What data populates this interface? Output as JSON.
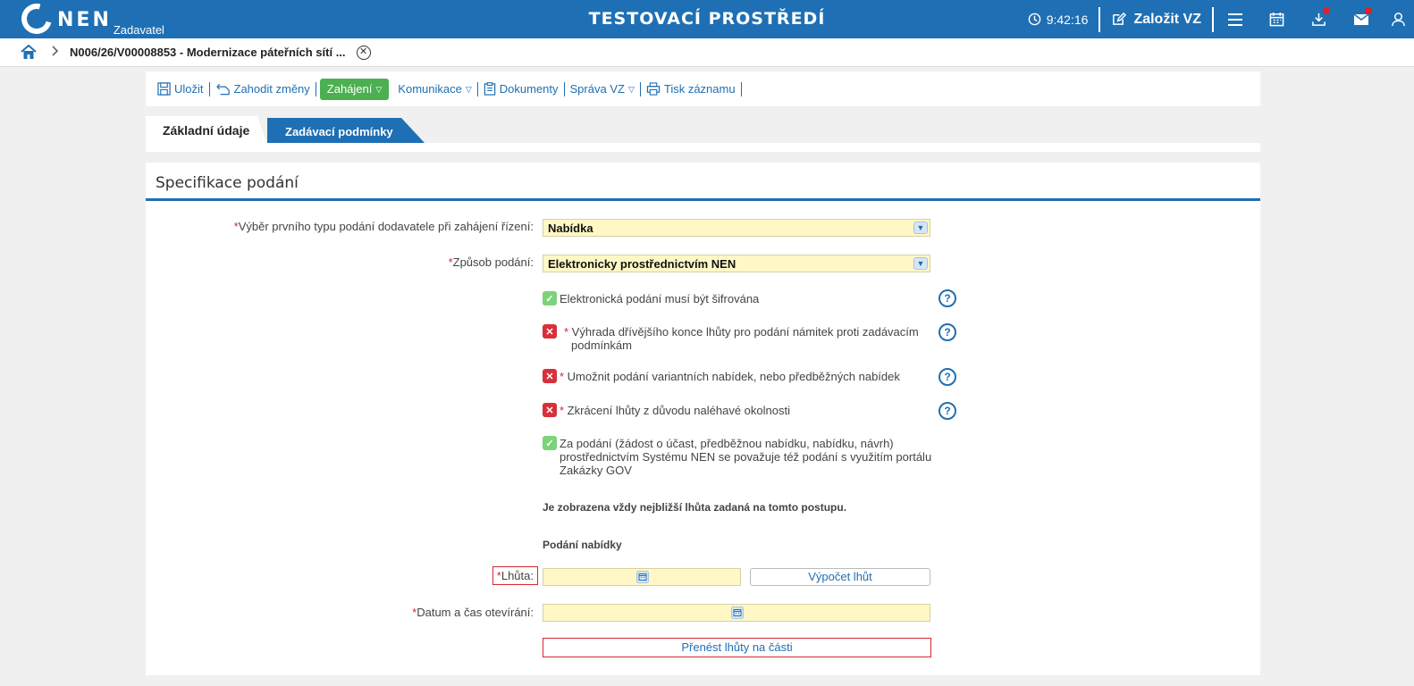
{
  "header": {
    "logo_text": "NEN",
    "logo_sub": "Zadavatel",
    "env_title": "TESTOVACÍ PROSTŘEDÍ",
    "clock": "9:42:16",
    "new_button": "Založit VZ"
  },
  "breadcrumb": {
    "title": "N006/26/V00008853 - Modernizace páteřních sítí ..."
  },
  "toolbar": {
    "save": "Uložit",
    "discard": "Zahodit změny",
    "start": "Zahájení",
    "communication": "Komunikace",
    "documents": "Dokumenty",
    "admin": "Správa VZ",
    "print": "Tisk záznamu"
  },
  "tabs": [
    "Základní údaje",
    "Zadávací podmínky"
  ],
  "section": {
    "title": "Specifikace podání",
    "first_type_label": "Výběr prvního typu podání dodavatele při zahájení řízení:",
    "first_type_value": "Nabídka",
    "method_label": "Způsob podání:",
    "method_value": "Elektronicky prostřednictvím NEN",
    "checks": [
      {
        "state": "ok",
        "required": false,
        "text": "Elektronická podání musí být šifrována"
      },
      {
        "state": "no",
        "required": true,
        "text": "Výhrada dřívějšího konce lhůty pro podání námitek proti zadávacím podmínkám"
      },
      {
        "state": "no",
        "required": true,
        "text": "Umožnit podání variantních nabídek, nebo předběžných nabídek"
      },
      {
        "state": "no",
        "required": true,
        "text": "Zkrácení lhůty z důvodu naléhavé okolnosti"
      },
      {
        "state": "ok",
        "required": false,
        "text": "Za podání (žádost o účast, předběžnou nabídku, nabídku, návrh) prostřednictvím Systému NEN se považuje též podání s využitím portálu Zakázky GOV"
      }
    ],
    "nearest_note": "Je zobrazena vždy nejbližší lhůta zadaná na tomto postupu.",
    "offer_heading": "Podání nabídky",
    "deadline_label": "Lhůta:",
    "calc_button": "Výpočet lhůt",
    "opening_label": "Datum a čas otevírání:",
    "transfer_button": "Přenést lhůty na části"
  },
  "colors": {
    "brand": "#1f6fb4",
    "accent_green": "#4caf50",
    "required_red": "#d0282f",
    "field_yellow": "#fff8c6"
  }
}
